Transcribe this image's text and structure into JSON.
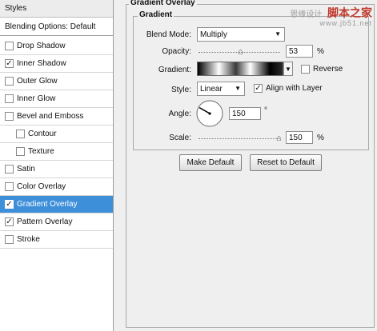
{
  "styles_list": {
    "header": "Styles",
    "blending_options": "Blending Options: Default",
    "items": [
      {
        "label": "Drop Shadow",
        "checked": false
      },
      {
        "label": "Inner Shadow",
        "checked": true
      },
      {
        "label": "Outer Glow",
        "checked": false
      },
      {
        "label": "Inner Glow",
        "checked": false
      },
      {
        "label": "Bevel and Emboss",
        "checked": false
      },
      {
        "label": "Contour",
        "checked": false
      },
      {
        "label": "Texture",
        "checked": false
      },
      {
        "label": "Satin",
        "checked": false
      },
      {
        "label": "Color Overlay",
        "checked": false
      },
      {
        "label": "Gradient Overlay",
        "checked": true
      },
      {
        "label": "Pattern Overlay",
        "checked": true
      },
      {
        "label": "Stroke",
        "checked": false
      }
    ],
    "check_glyph": "✓"
  },
  "panel": {
    "section_title": "Gradient Overlay",
    "group_title": "Gradient",
    "blend_mode": {
      "label": "Blend Mode:",
      "value": "Multiply"
    },
    "opacity": {
      "label": "Opacity:",
      "value": "53",
      "unit": "%",
      "level": 0.53
    },
    "gradient": {
      "label": "Gradient:",
      "reverse_label": "Reverse",
      "reverse_checked": false
    },
    "style": {
      "label": "Style:",
      "value": "Linear",
      "align_label": "Align with Layer",
      "align_checked": true
    },
    "angle": {
      "label": "Angle:",
      "value": "150",
      "unit": "°",
      "degrees": 150
    },
    "scale": {
      "label": "Scale:",
      "value": "150",
      "unit": "%",
      "level": 1.0
    },
    "buttons": {
      "make_default": "Make Default",
      "reset_default": "Reset to Default"
    }
  },
  "watermark": {
    "text": "思缘设计",
    "brand": "脚本之家",
    "url": "www.jb51.net"
  },
  "colors": {
    "selection": "#3d8fda",
    "background": "#efefef"
  }
}
